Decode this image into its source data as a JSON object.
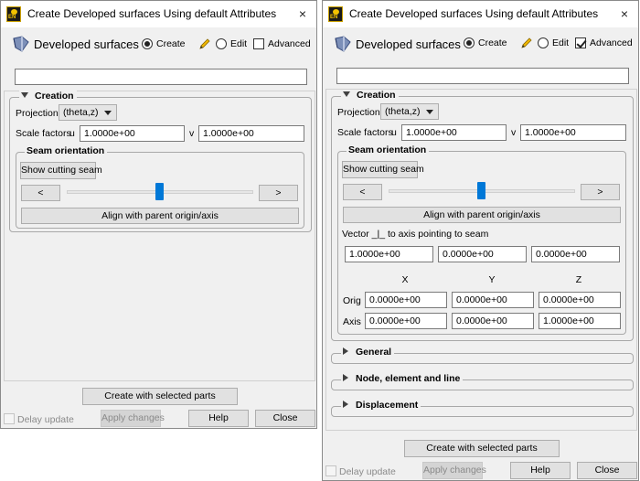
{
  "dialog": {
    "title": "Create Developed surfaces Using default Attributes",
    "header_title": "Developed surfaces",
    "mode_create": "Create",
    "mode_edit": "Edit",
    "advanced_label": "Advanced",
    "name_value": "",
    "creation_legend": "Creation",
    "projection_label": "Projection",
    "projection_value": "(theta,z)",
    "scale_label": "Scale factors",
    "scale_u_label": "u",
    "scale_u_value": "1.0000e+00",
    "scale_v_label": "v",
    "scale_v_value": "1.0000e+00",
    "seam_legend": "Seam orientation",
    "show_seam_label": "Show cutting seam",
    "prev_label": "<",
    "next_label": ">",
    "align_label": "Align with parent origin/axis",
    "vector_label": "Vector _|_ to axis pointing to seam",
    "vector_values": [
      "1.0000e+00",
      "0.0000e+00",
      "0.0000e+00"
    ],
    "col_x": "X",
    "col_y": "Y",
    "col_z": "Z",
    "orig_label": "Orig",
    "orig_values": [
      "0.0000e+00",
      "0.0000e+00",
      "0.0000e+00"
    ],
    "axis_label": "Axis",
    "axis_values": [
      "0.0000e+00",
      "0.0000e+00",
      "1.0000e+00"
    ],
    "general_label": "General",
    "node_label": "Node, element and line",
    "displacement_label": "Displacement",
    "create_selected_label": "Create with selected parts",
    "delay_update_label": "Delay update",
    "apply_label": "Apply changes",
    "help_label": "Help",
    "close_label": "Close",
    "close_icon": "×",
    "slider_position": 0.5
  },
  "left_state": {
    "advanced_checked": false,
    "mode": "create"
  },
  "right_state": {
    "advanced_checked": true,
    "mode": "create"
  },
  "colors": {
    "accent": "#0078d7",
    "window_bg": "#f0f0f0"
  }
}
